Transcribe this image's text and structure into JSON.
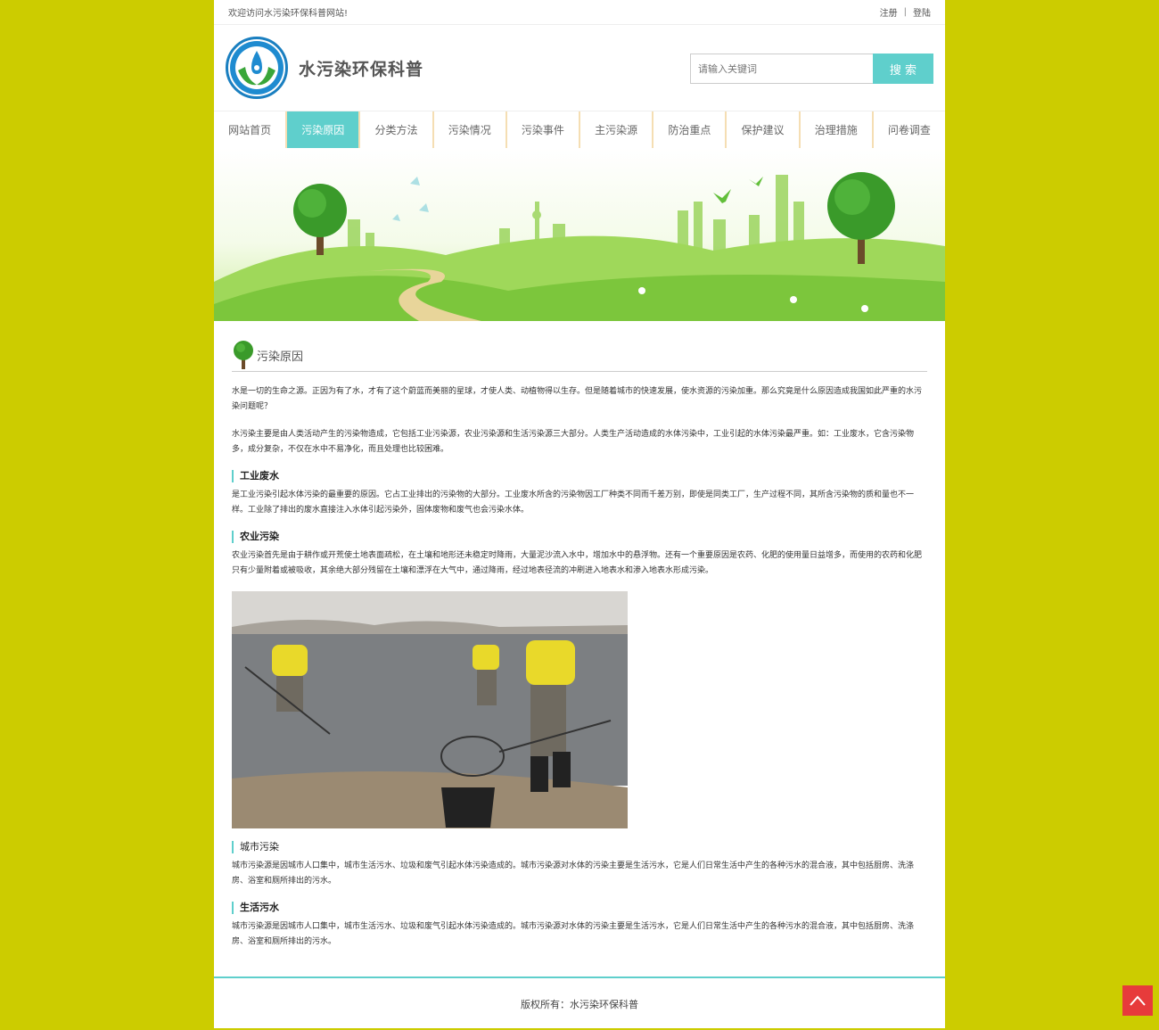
{
  "topbar": {
    "welcome": "欢迎访问水污染环保科普网站!",
    "register": "注册",
    "sep": "|",
    "login": "登陆"
  },
  "header": {
    "site_title": "水污染环保科普",
    "search_placeholder": "请输入关键词",
    "search_button": "搜 索"
  },
  "nav": [
    "网站首页",
    "污染原因",
    "分类方法",
    "污染情况",
    "污染事件",
    "主污染源",
    "防治重点",
    "保护建议",
    "治理措施",
    "问卷调查"
  ],
  "nav_active": 1,
  "section": {
    "title": "污染原因",
    "intro1": "水是一切的生命之源。正因为有了水，才有了这个蔚蓝而美丽的星球，才使人类、动植物得以生存。但是随着城市的快速发展，使水资源的污染加重。那么究竟是什么原因造成我国如此严重的水污染问题呢？",
    "intro2": "水污染主要是由人类活动产生的污染物造成，它包括工业污染源，农业污染源和生活污染源三大部分。人类生产活动造成的水体污染中，工业引起的水体污染最严重。如：工业废水，它含污染物多，成分复杂，不仅在水中不易净化，而且处理也比较困难。",
    "sub1_title": "工业废水",
    "sub1_text": "是工业污染引起水体污染的最重要的原因。它占工业排出的污染物的大部分。工业废水所含的污染物因工厂种类不同而千差万别，即使是同类工厂，生产过程不同，其所含污染物的质和量也不一样。工业除了排出的废水直接注入水体引起污染外，固体废物和废气也会污染水体。",
    "sub2_title": "农业污染",
    "sub2_text": "农业污染首先是由于耕作或开荒使土地表面疏松，在土壤和地形还未稳定时降雨，大量泥沙流入水中，增加水中的悬浮物。还有一个重要原因是农药、化肥的使用量日益增多，而使用的农药和化肥只有少量附着或被吸收，其余绝大部分残留在土壤和漂浮在大气中，通过降雨，经过地表径流的冲刷进入地表水和渗入地表水形成污染。",
    "sub3_title": "城市污染",
    "sub3_text": "城市污染源是因城市人口集中，城市生活污水、垃圾和废气引起水体污染造成的。城市污染源对水体的污染主要是生活污水，它是人们日常生活中产生的各种污水的混合液，其中包括厨房、洗涤房、浴室和厕所排出的污水。",
    "sub4_title": "生活污水",
    "sub4_text": "城市污染源是因城市人口集中，城市生活污水、垃圾和废气引起水体污染造成的。城市污染源对水体的污染主要是生活污水，它是人们日常生活中产生的各种污水的混合液，其中包括厨房、洗涤房、浴室和厕所排出的污水。"
  },
  "footer": {
    "copyright": "版权所有：水污染环保科普"
  },
  "colors": {
    "page_bg": "#cccc00",
    "accent": "#5fcfcc",
    "totop": "#e73b3b"
  },
  "icons": [
    "tree-icon",
    "arrow-up-icon",
    "logo-icon"
  ]
}
